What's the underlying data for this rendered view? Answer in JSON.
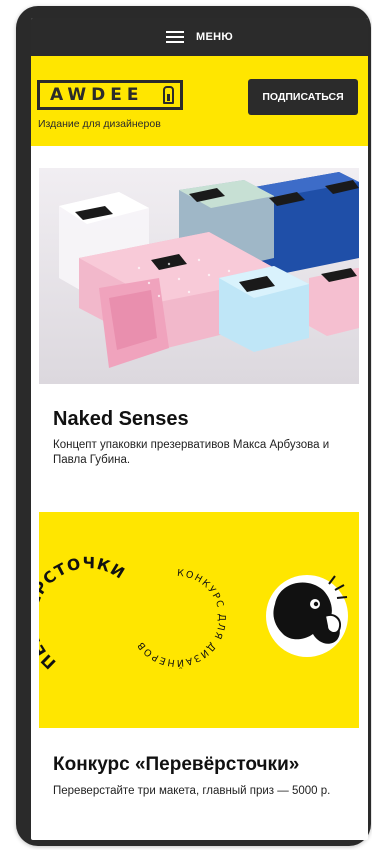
{
  "topbar": {
    "menu_label": "МЕНЮ"
  },
  "header": {
    "logo_text": "AWDEE",
    "tagline": "Издание для дизайнеров",
    "subscribe_label": "ПОДПИСАТЬСЯ"
  },
  "articles": [
    {
      "title": "Naked Senses",
      "description": "Концепт упаковки презервативов Макса Арбузова и Павла Губина."
    },
    {
      "title": "Конкурс «Перевёрсточки»",
      "description": "Переверстайте три макета, главный приз — 5000 р.",
      "art_left": "ПЕРЕВЁРСТОЧКИ",
      "art_middle": "КОНКУРС ДЛЯ ДИЗАЙНЕРОВ"
    }
  ],
  "colors": {
    "accent": "#ffe600",
    "dark": "#2b2b2b"
  }
}
